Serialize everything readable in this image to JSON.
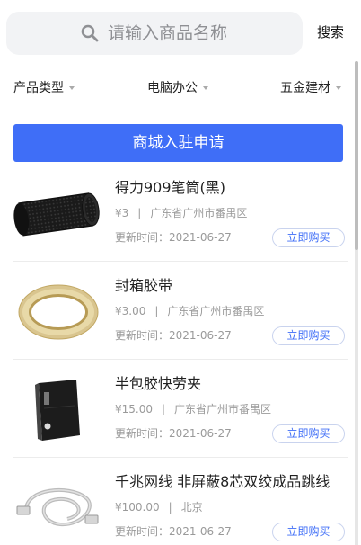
{
  "search": {
    "placeholder": "请输入商品名称",
    "button_label": "搜索",
    "icon": "search-icon"
  },
  "filters": [
    {
      "label": "产品类型"
    },
    {
      "label": "电脑办公"
    },
    {
      "label": "五金建材"
    }
  ],
  "apply_button_label": "商城入驻申请",
  "colors": {
    "accent": "#3f6ef7",
    "search_bg": "#f2f3f5",
    "muted_text": "#9a9a9a"
  },
  "products": [
    {
      "title": "得力909笔筒(黑)",
      "price": "¥3",
      "separator": "|",
      "location": "广东省广州市番禺区",
      "updated": "更新时间：2021-06-27",
      "buy_label": "立即购买",
      "image": "pen-holder-image"
    },
    {
      "title": "封箱胶带",
      "price": "¥3.00",
      "separator": "|",
      "location": "广东省广州市番禺区",
      "updated": "更新时间：2021-06-27",
      "buy_label": "立即购买",
      "image": "tape-image"
    },
    {
      "title": "半包胶快劳夹",
      "price": "¥15.00",
      "separator": "|",
      "location": "广东省广州市番禺区",
      "updated": "更新时间：2021-06-27",
      "buy_label": "立即购买",
      "image": "binder-image"
    },
    {
      "title": "千兆网线 非屏蔽8芯双绞成品跳线",
      "price": "¥100.00",
      "separator": "|",
      "location": "北京",
      "updated": "更新时间：2021-06-27",
      "buy_label": "立即购买",
      "image": "network-cable-image"
    }
  ]
}
